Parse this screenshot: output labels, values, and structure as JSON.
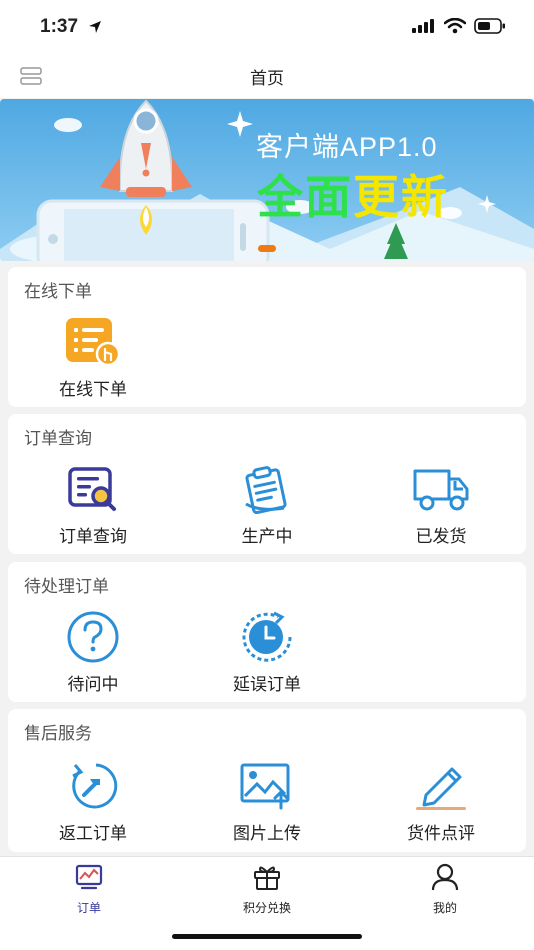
{
  "status_bar": {
    "time": "1:37"
  },
  "nav": {
    "title": "首页"
  },
  "banner": {
    "line1": "客户端APP1.0",
    "line2_a": "全面",
    "line2_b": "更新"
  },
  "sections": [
    {
      "title": "在线下单",
      "items": [
        {
          "label": "在线下单",
          "icon": "order-form-icon"
        }
      ]
    },
    {
      "title": "订单查询",
      "items": [
        {
          "label": "订单查询",
          "icon": "order-search-icon"
        },
        {
          "label": "生产中",
          "icon": "clipboard-icon"
        },
        {
          "label": "已发货",
          "icon": "truck-icon"
        }
      ]
    },
    {
      "title": "待处理订单",
      "items": [
        {
          "label": "待问中",
          "icon": "question-icon"
        },
        {
          "label": "延误订单",
          "icon": "clock-icon"
        }
      ]
    },
    {
      "title": "售后服务",
      "items": [
        {
          "label": "返工订单",
          "icon": "rework-icon"
        },
        {
          "label": "图片上传",
          "icon": "image-upload-icon"
        },
        {
          "label": "货件点评",
          "icon": "pencil-icon"
        }
      ]
    }
  ],
  "tabs": [
    {
      "label": "订单",
      "icon": "chart-monitor-icon",
      "active": true
    },
    {
      "label": "积分兑换",
      "icon": "gift-icon",
      "active": false
    },
    {
      "label": "我的",
      "icon": "person-icon",
      "active": false
    }
  ],
  "colors": {
    "accent_blue": "#2a8fd6",
    "orange": "#f5a623",
    "active_tab": "#3a3a9a"
  }
}
